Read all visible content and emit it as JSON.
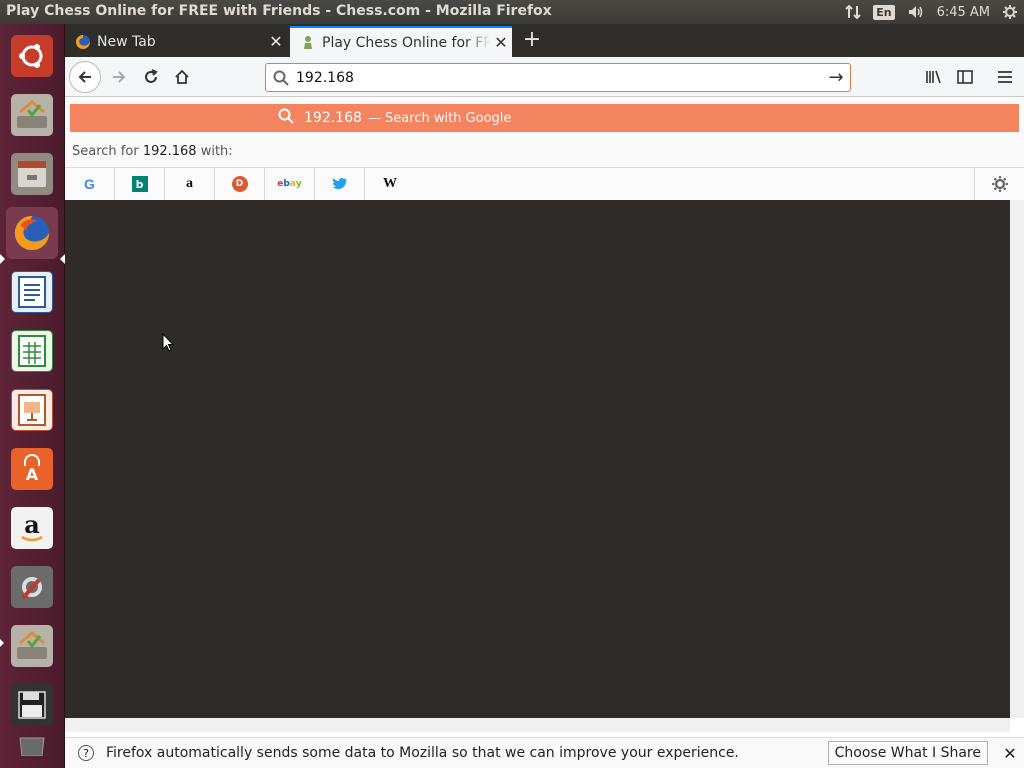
{
  "system": {
    "window_title": "Play Chess Online for FREE with Friends - Chess.com - Mozilla Firefox",
    "language": "En",
    "time": "6:45 AM"
  },
  "launcher": {
    "items": [
      {
        "name": "ubuntu-logo-icon"
      },
      {
        "name": "install-ubuntu-icon"
      },
      {
        "name": "file-manager-icon"
      },
      {
        "name": "firefox-icon"
      },
      {
        "name": "writer-icon"
      },
      {
        "name": "calc-icon"
      },
      {
        "name": "impress-icon"
      },
      {
        "name": "software-center-icon"
      },
      {
        "name": "amazon-icon"
      },
      {
        "name": "settings-icon"
      },
      {
        "name": "install-ubuntu-icon"
      },
      {
        "name": "floppy-icon"
      },
      {
        "name": "trash-icon"
      }
    ]
  },
  "tabs": [
    {
      "label": "New Tab",
      "active": false
    },
    {
      "label": "Play Chess Online for FREE with Friends - Chess.com",
      "active": true
    }
  ],
  "urlbar": {
    "value": "192.168"
  },
  "dropdown": {
    "suggestion_term": "192.168",
    "suggestion_action": "— Search with Google",
    "search_for_prefix": "Search for",
    "search_for_term": "192.168",
    "search_for_suffix": "with:",
    "engines": [
      "Google",
      "Bing",
      "Amazon",
      "DuckDuckGo",
      "eBay",
      "Twitter",
      "Wikipedia"
    ]
  },
  "notification": {
    "message": "Firefox automatically sends some data to Mozilla so that we can improve your experience.",
    "button": "Choose What I Share"
  },
  "colors": {
    "suggestion_bg": "#f4845f",
    "content_bg": "#2e2b28",
    "launcher_bg": "#5e2437"
  }
}
